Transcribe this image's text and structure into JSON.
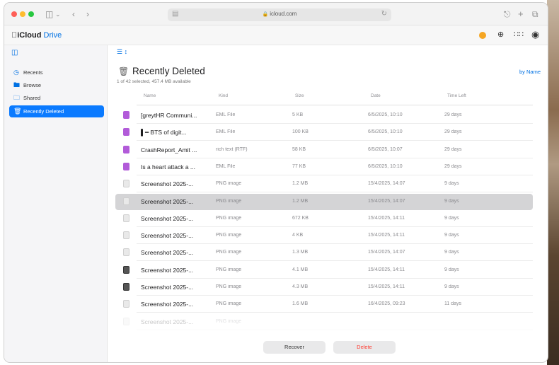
{
  "browser": {
    "url": "icloud.com",
    "icons": [
      "sidebar-toggle-icon",
      "back-icon",
      "forward-icon",
      "share-icon",
      "new-tab-icon",
      "tabs-overview-icon",
      "reload-icon",
      "lock-icon"
    ]
  },
  "app": {
    "brand": "iCloud",
    "product": "Drive",
    "header_icons": [
      "notification-dot",
      "upload-icon",
      "apps-grid-icon",
      "account-icon"
    ],
    "accent": "#0071e3"
  },
  "sidebar": {
    "items": [
      {
        "label": "Recents",
        "icon": "clock-icon"
      },
      {
        "label": "Browse",
        "icon": "folder-icon"
      },
      {
        "label": "Shared",
        "icon": "shared-folder-icon"
      },
      {
        "label": "Recently Deleted",
        "icon": "trash-icon",
        "active": true
      }
    ]
  },
  "main": {
    "title": "Recently Deleted",
    "subtitle": "1 of 42 selected, 457.4 MB available",
    "sort_label": "by Name",
    "columns": [
      "Name",
      "Kind",
      "Size",
      "Date",
      "Time Left"
    ],
    "rows": [
      {
        "name": "[greytHR Communi...",
        "kind": "EML File",
        "size": "5 KB",
        "date": "6/5/2025, 10:10",
        "time_left": "29 days",
        "icon": "eml"
      },
      {
        "name": "▌━ BTS of digit...",
        "kind": "EML File",
        "size": "100 KB",
        "date": "6/5/2025, 10:10",
        "time_left": "29 days",
        "icon": "eml"
      },
      {
        "name": "CrashReport_Amit ...",
        "kind": "rich text (RTF)",
        "size": "58 KB",
        "date": "6/5/2025, 10:07",
        "time_left": "29 days",
        "icon": "eml"
      },
      {
        "name": "Is a heart attack a ...",
        "kind": "EML File",
        "size": "77 KB",
        "date": "6/5/2025, 10:10",
        "time_left": "29 days",
        "icon": "eml"
      },
      {
        "name": "Screenshot 2025-...",
        "kind": "PNG image",
        "size": "1.2 MB",
        "date": "15/4/2025, 14:07",
        "time_left": "9 days",
        "icon": "png"
      },
      {
        "name": "Screenshot 2025-...",
        "kind": "PNG image",
        "size": "1.2 MB",
        "date": "15/4/2025, 14:07",
        "time_left": "9 days",
        "icon": "png",
        "selected": true
      },
      {
        "name": "Screenshot 2025-...",
        "kind": "PNG image",
        "size": "672 KB",
        "date": "15/4/2025, 14:11",
        "time_left": "9 days",
        "icon": "png"
      },
      {
        "name": "Screenshot 2025-...",
        "kind": "PNG image",
        "size": "4 KB",
        "date": "15/4/2025, 14:11",
        "time_left": "9 days",
        "icon": "png"
      },
      {
        "name": "Screenshot 2025-...",
        "kind": "PNG image",
        "size": "1.3 MB",
        "date": "15/4/2025, 14:07",
        "time_left": "9 days",
        "icon": "png"
      },
      {
        "name": "Screenshot 2025-...",
        "kind": "PNG image",
        "size": "4.1 MB",
        "date": "15/4/2025, 14:11",
        "time_left": "9 days",
        "icon": "pngdark"
      },
      {
        "name": "Screenshot 2025-...",
        "kind": "PNG image",
        "size": "4.3 MB",
        "date": "15/4/2025, 14:11",
        "time_left": "9 days",
        "icon": "pngdark"
      },
      {
        "name": "Screenshot 2025-...",
        "kind": "PNG image",
        "size": "1.6 MB",
        "date": "16/4/2025, 09:23",
        "time_left": "11 days",
        "icon": "png"
      },
      {
        "name": "Screenshot 2025-...",
        "kind": "PNG image",
        "size": "",
        "date": "",
        "time_left": "",
        "icon": "png",
        "faded": true
      }
    ],
    "buttons": {
      "recover": "Recover",
      "delete": "Delete"
    },
    "delete_color": "#ff3b30"
  }
}
